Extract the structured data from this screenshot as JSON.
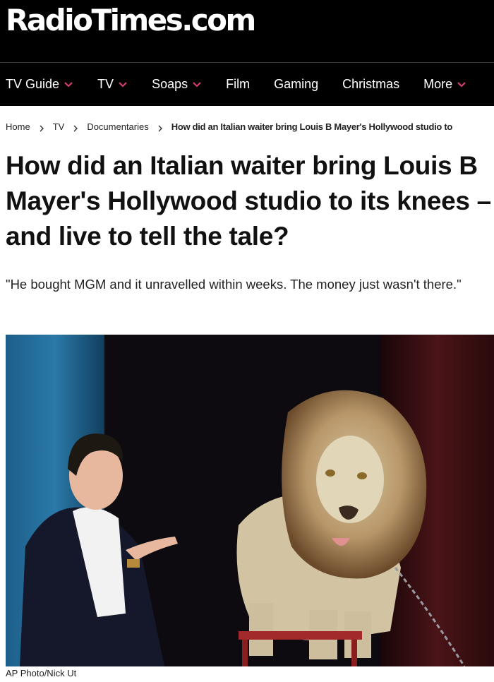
{
  "site": {
    "logo_text": "RadioTimes.com"
  },
  "nav": {
    "items": [
      {
        "label": "TV Guide",
        "has_dropdown": true
      },
      {
        "label": "TV",
        "has_dropdown": true
      },
      {
        "label": "Soaps",
        "has_dropdown": true
      },
      {
        "label": "Film",
        "has_dropdown": false
      },
      {
        "label": "Gaming",
        "has_dropdown": false
      },
      {
        "label": "Christmas",
        "has_dropdown": false
      },
      {
        "label": "More",
        "has_dropdown": true
      }
    ],
    "accent_color": "#e0407a"
  },
  "breadcrumb": {
    "items": [
      "Home",
      "TV",
      "Documentaries"
    ],
    "current": "How did an Italian waiter bring Louis B Mayer's Hollywood studio to"
  },
  "article": {
    "headline": "How did an Italian waiter bring Louis B Mayer's Hollywood studio to its knees – and live to tell the tale?",
    "standfirst": "\"He bought MGM and it unravelled within weeks. The money just wasn't there.\"",
    "image_credit": "AP Photo/Nick Ut"
  }
}
